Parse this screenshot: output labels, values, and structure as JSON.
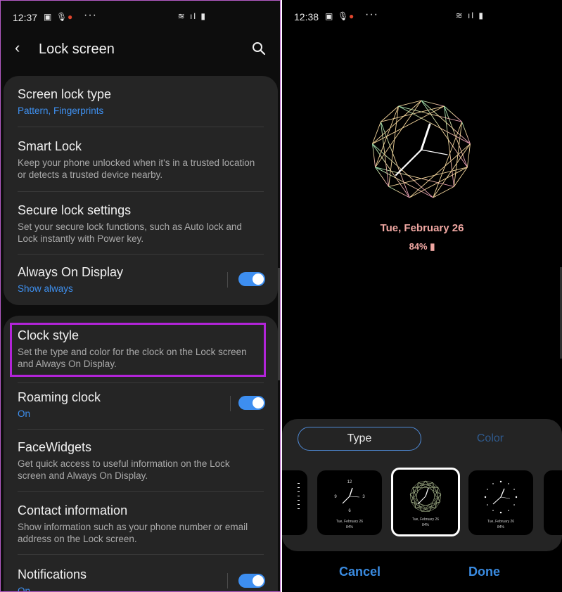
{
  "left": {
    "status": {
      "time": "12:37",
      "more": "···"
    },
    "header": {
      "title": "Lock screen",
      "back_icon": "back-arrow-icon",
      "search_icon": "search-icon"
    },
    "items": [
      {
        "title": "Screen lock type",
        "subtitle": "Pattern, Fingerprints"
      },
      {
        "title": "Smart Lock",
        "subtitle_line1": "Keep your phone unlocked when it's in a trusted location",
        "subtitle_line2": "or detects a trusted device nearby."
      },
      {
        "title": "Secure lock settings",
        "subtitle_line1": "Set your secure lock functions, such as Auto lock and",
        "subtitle_line2": "Lock instantly with Power key."
      },
      {
        "title": "Always On Display",
        "subtitle": "Show always",
        "toggle_on": true
      },
      {
        "title": "Clock style",
        "subtitle_line1": "Set the type and color for the clock on the Lock screen",
        "subtitle_line2": "and Always On Display."
      },
      {
        "title": "Roaming clock",
        "subtitle": "On",
        "toggle_on": true
      },
      {
        "title": "FaceWidgets",
        "subtitle_line1": "Get quick access to useful information on the Lock",
        "subtitle_line2": "screen and Always On Display."
      },
      {
        "title": "Contact information",
        "subtitle_line1": "Show information such as your phone number or email",
        "subtitle_line2": "address on the Lock screen."
      },
      {
        "title": "Notifications",
        "subtitle": "On",
        "toggle_on": true
      }
    ]
  },
  "right": {
    "status": {
      "time": "12:38",
      "more": "···"
    },
    "preview": {
      "date": "Tue, February 26",
      "battery": "84%"
    },
    "tabs": {
      "type": "Type",
      "color": "Color"
    },
    "thumbs": [
      {
        "date": "Tue, February 26",
        "battery": "84%"
      },
      {
        "date": "Tue, February 26",
        "battery": "84%"
      },
      {
        "date": "Tue, February 26",
        "battery": "84%"
      }
    ],
    "thumb_numerals": {
      "n12": "12",
      "n3": "3",
      "n6": "6",
      "n9": "9"
    },
    "buttons": {
      "cancel": "Cancel",
      "done": "Done"
    }
  },
  "colors": {
    "accent": "#3d8ef0",
    "highlight": "#b224d8",
    "date_pink": "#f0a7a2",
    "card": "#252525"
  }
}
